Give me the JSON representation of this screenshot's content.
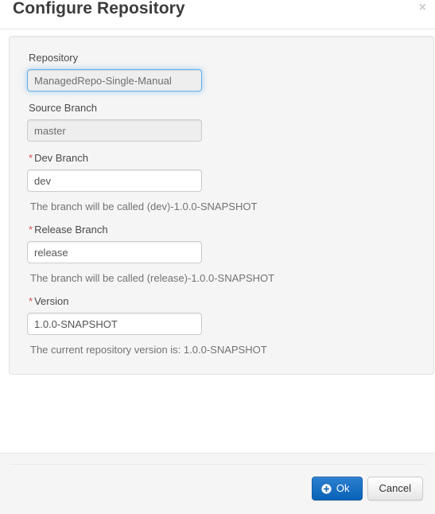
{
  "dialog": {
    "title": "Configure Repository",
    "close_label": "×",
    "close_icon": "close-icon"
  },
  "form": {
    "fields": [
      {
        "label": "Repository",
        "required": false,
        "value": "ManagedRepo-Single-Manual",
        "placeholder": "",
        "disabled": true,
        "focused": true,
        "help": ""
      },
      {
        "label": "Source Branch",
        "required": false,
        "value": "master",
        "placeholder": "",
        "disabled": true,
        "focused": false,
        "help": ""
      },
      {
        "label": "Dev Branch",
        "required": true,
        "value": "dev",
        "placeholder": "",
        "disabled": false,
        "focused": false,
        "help": "The branch will be called (dev)-1.0.0-SNAPSHOT"
      },
      {
        "label": "Release Branch",
        "required": true,
        "value": "release",
        "placeholder": "",
        "disabled": false,
        "focused": false,
        "help": "The branch will be called (release)-1.0.0-SNAPSHOT"
      },
      {
        "label": "Version",
        "required": true,
        "value": "1.0.0-SNAPSHOT",
        "placeholder": "",
        "disabled": false,
        "focused": false,
        "help": "The current repository version is: 1.0.0-SNAPSHOT"
      }
    ],
    "required_marker": "*"
  },
  "footer": {
    "ok_label": "Ok",
    "ok_icon": "plus-circle-icon",
    "cancel_label": "Cancel"
  },
  "colors": {
    "primary": "#1169bd",
    "required": "#d9534f",
    "focus_ring": "#66afe9",
    "panel_bg": "#f5f5f5",
    "panel_border": "#e3e3e3",
    "text": "#333333",
    "help_text": "#737373"
  }
}
